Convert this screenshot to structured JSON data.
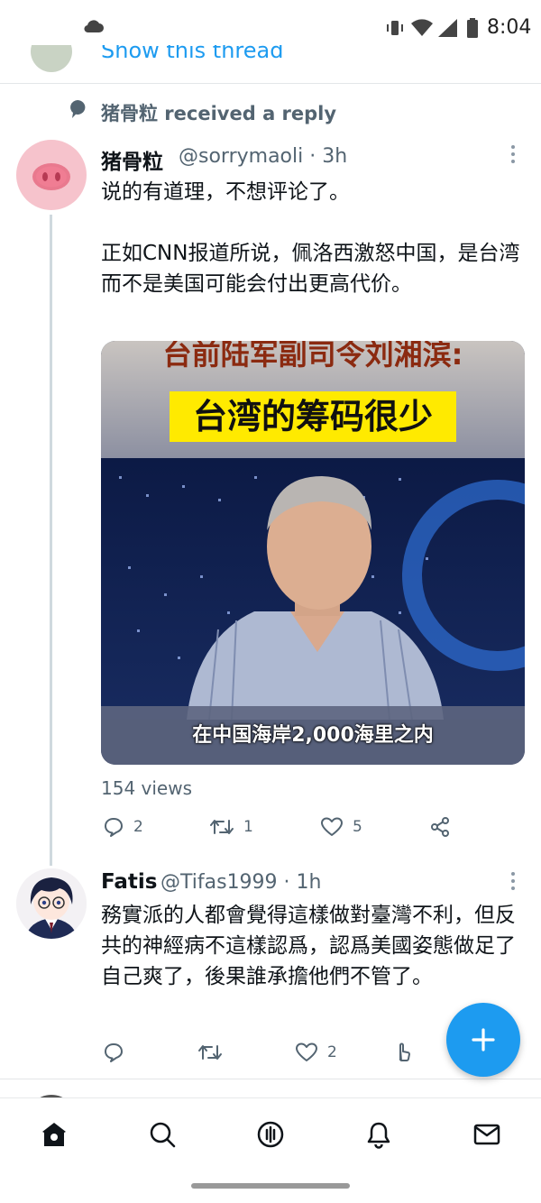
{
  "status_bar": {
    "time": "8:04"
  },
  "previous_thread": {
    "show_thread_label": "Show this thread"
  },
  "notification": {
    "reply_header": "猪骨粒 received a reply"
  },
  "tweets": [
    {
      "display_name": "猪骨粒",
      "handle_time": "@sorrymaoli · 3h",
      "text": "说的有道理，不想评论了。\n\n正如CNN报道所说，佩洛西激怒中国，是台湾而不是美国可能会付出更高代价。",
      "media": {
        "headline": "台前陆军副司令刘湘滨:",
        "banner": "台湾的筹码很少",
        "subtitle": "在中国海岸2,000海里之内"
      },
      "views": "154 views",
      "actions": {
        "replies": "2",
        "retweets": "1",
        "likes": "5"
      }
    },
    {
      "display_name": "Fatis",
      "handle_time": "@Tifas1999 · 1h",
      "text": "務實派的人都會覺得這樣做對臺灣不利，但反共的神經病不這樣認爲，認爲美國姿態做足了自己爽了，後果誰承擔他們不管了。",
      "actions": {
        "replies": "",
        "retweets": "",
        "likes": "2"
      }
    }
  ],
  "colors": {
    "accent": "#1d9bf0",
    "secondary_text": "#536471",
    "banner_yellow": "#ffea00"
  },
  "nav": [
    "home-icon",
    "search-icon",
    "spaces-icon",
    "notifications-icon",
    "messages-icon"
  ]
}
